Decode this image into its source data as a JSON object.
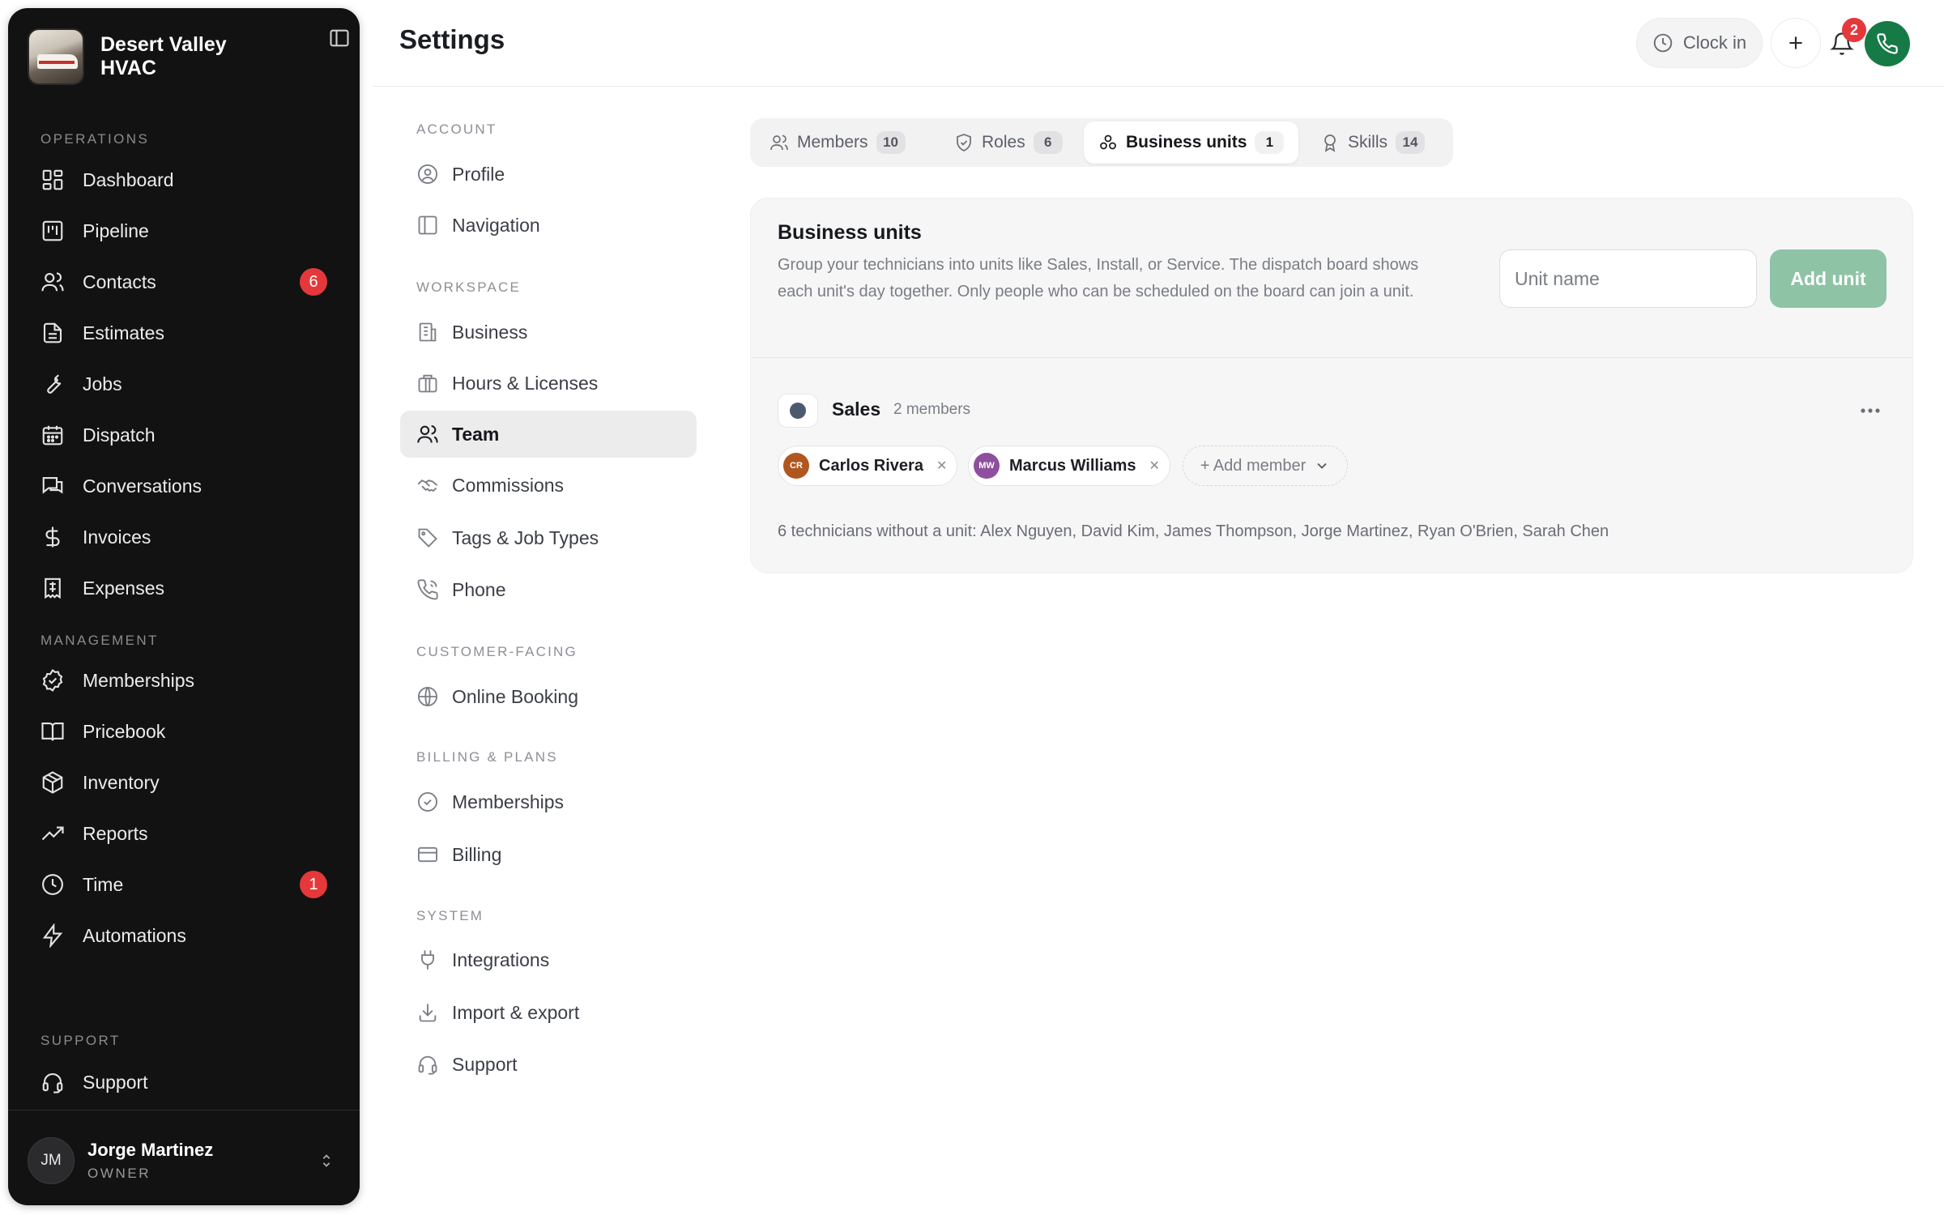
{
  "brand": {
    "name": "Desert Valley HVAC"
  },
  "sidebar": {
    "sections": {
      "operations": "OPERATIONS",
      "management": "MANAGEMENT",
      "support": "SUPPORT"
    },
    "operations_items": [
      {
        "label": "Dashboard",
        "icon": "dashboard-icon"
      },
      {
        "label": "Pipeline",
        "icon": "pipeline-icon"
      },
      {
        "label": "Contacts",
        "icon": "contacts-icon",
        "badge": "6"
      },
      {
        "label": "Estimates",
        "icon": "estimates-icon"
      },
      {
        "label": "Jobs",
        "icon": "wrench-icon"
      },
      {
        "label": "Dispatch",
        "icon": "calendar-icon"
      },
      {
        "label": "Conversations",
        "icon": "chat-icon"
      },
      {
        "label": "Invoices",
        "icon": "dollar-icon"
      },
      {
        "label": "Expenses",
        "icon": "receipt-icon"
      }
    ],
    "management_items": [
      {
        "label": "Memberships",
        "icon": "check-circle-icon"
      },
      {
        "label": "Pricebook",
        "icon": "book-icon"
      },
      {
        "label": "Inventory",
        "icon": "box-icon"
      },
      {
        "label": "Reports",
        "icon": "trend-icon"
      },
      {
        "label": "Time",
        "icon": "clock-icon",
        "badge": "1"
      },
      {
        "label": "Automations",
        "icon": "bolt-icon"
      }
    ],
    "support_items": [
      {
        "label": "Support",
        "icon": "headset-icon"
      }
    ],
    "user": {
      "initials": "JM",
      "name": "Jorge Martinez",
      "role": "OWNER"
    }
  },
  "header": {
    "title": "Settings",
    "clock_in": "Clock in",
    "notifications_count": "2"
  },
  "settings_nav": {
    "sections": {
      "account": "ACCOUNT",
      "workspace": "WORKSPACE",
      "customer_facing": "CUSTOMER-FACING",
      "billing_plans": "BILLING & PLANS",
      "system": "SYSTEM"
    },
    "account_items": [
      "Profile",
      "Navigation"
    ],
    "workspace_items": [
      "Business",
      "Hours & Licenses",
      "Team",
      "Commissions",
      "Tags & Job Types",
      "Phone"
    ],
    "customer_items": [
      "Online Booking"
    ],
    "billing_items": [
      "Memberships",
      "Billing"
    ],
    "system_items": [
      "Integrations",
      "Import & export",
      "Support"
    ],
    "active": "Team"
  },
  "tabs": [
    {
      "label": "Members",
      "count": "10"
    },
    {
      "label": "Roles",
      "count": "6"
    },
    {
      "label": "Business units",
      "count": "1",
      "active": true
    },
    {
      "label": "Skills",
      "count": "14"
    }
  ],
  "business_units": {
    "title": "Business units",
    "description": "Group your technicians into units like Sales, Install, or Service. The dispatch board shows each unit's day together. Only people who can be scheduled on the board can join a unit.",
    "input_placeholder": "Unit name",
    "add_button": "Add unit",
    "units": [
      {
        "name": "Sales",
        "member_count": "2 members",
        "color": "#4c5a70",
        "members": [
          {
            "initials": "CR",
            "name": "Carlos Rivera",
            "color": "#b0561f"
          },
          {
            "initials": "MW",
            "name": "Marcus Williams",
            "color": "#8e4f9e"
          }
        ],
        "add_member": "+ Add member"
      }
    ],
    "unassigned": "6 technicians without a unit: Alex Nguyen, David Kim, James Thompson, Jorge Martinez, Ryan O'Brien, Sarah Chen"
  },
  "colors": {
    "sidebar_bg": "#121212",
    "badge_red": "#e5383b",
    "phone_green": "#167a46",
    "add_unit_green": "#8fc3a6"
  }
}
